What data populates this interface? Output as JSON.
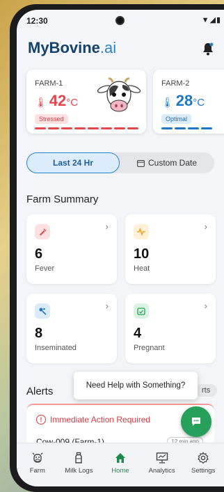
{
  "status": {
    "time": "12:30",
    "icons": "▼◢▮"
  },
  "header": {
    "brand_main": "MyBovine",
    "brand_suffix": ".ai"
  },
  "farms": [
    {
      "name": "FARM-1",
      "temp": "42",
      "unit": "°C",
      "status": "Stressed",
      "color": "#e2474c"
    },
    {
      "name": "FARM-2",
      "temp": "28",
      "unit": "°C",
      "status": "Optimal",
      "color": "#1f77c2"
    }
  ],
  "filter": {
    "active": "Last 24 Hr",
    "other": "Custom Date"
  },
  "summary": {
    "title": "Farm Summary",
    "fever": {
      "value": "6",
      "label": "Fever"
    },
    "heat": {
      "value": "10",
      "label": "Heat"
    },
    "inseminated": {
      "value": "8",
      "label": "Inseminated"
    },
    "pregnant": {
      "value": "4",
      "label": "Pregnant"
    }
  },
  "alerts": {
    "title": "Alerts",
    "view_all_partial": "rts",
    "heading": "Immediate Action Required",
    "cow": "Cow-009 (Farm-1)",
    "time": "12 min ago"
  },
  "help": {
    "tooltip": "Need Help with Something?"
  },
  "nav": {
    "farm": "Farm",
    "milk_logs": "Milk Logs",
    "home": "Home",
    "analytics": "Analytics",
    "settings": "Settings"
  }
}
